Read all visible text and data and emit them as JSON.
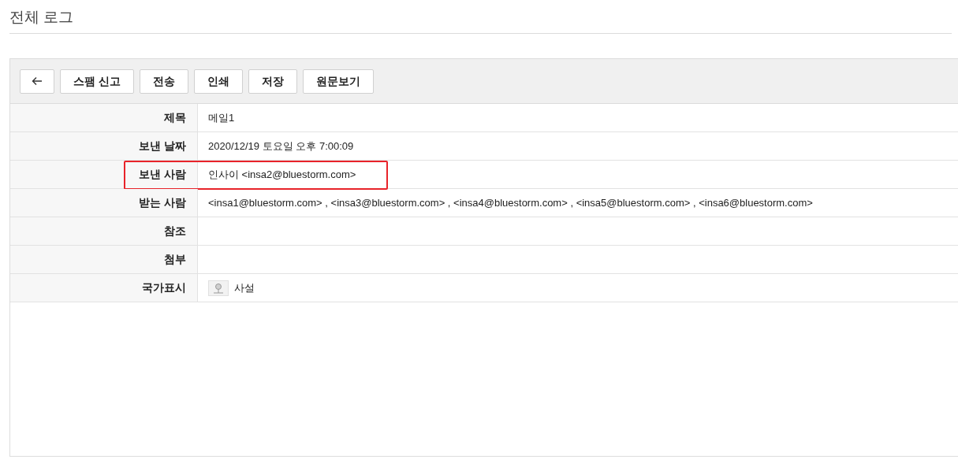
{
  "page_title": "전체 로그",
  "toolbar": [
    {
      "kind": "back"
    },
    {
      "kind": "text",
      "label": "스팸 신고"
    },
    {
      "kind": "text",
      "label": "전송"
    },
    {
      "kind": "text",
      "label": "인쇄"
    },
    {
      "kind": "text",
      "label": "저장"
    },
    {
      "kind": "text",
      "label": "원문보기"
    }
  ],
  "rows": [
    {
      "label": "제목",
      "value": "메일1",
      "highlighted": false
    },
    {
      "label": "보낸 날짜",
      "value": "2020/12/19 토요일 오후 7:00:09",
      "highlighted": false
    },
    {
      "label": "보낸 사람",
      "value": "인사이 <insa2@bluestorm.com>",
      "highlighted": true
    },
    {
      "label": "받는 사람",
      "value": "<insa1@bluestorm.com> , <insa3@bluestorm.com> , <insa4@bluestorm.com> , <insa5@bluestorm.com> , <insa6@bluestorm.com>",
      "highlighted": false
    },
    {
      "label": "참조",
      "highlighted": false
    },
    {
      "label": "첨부",
      "highlighted": false
    },
    {
      "label": "국가표시",
      "value": "사설",
      "kind": "location",
      "highlighted": false
    }
  ]
}
